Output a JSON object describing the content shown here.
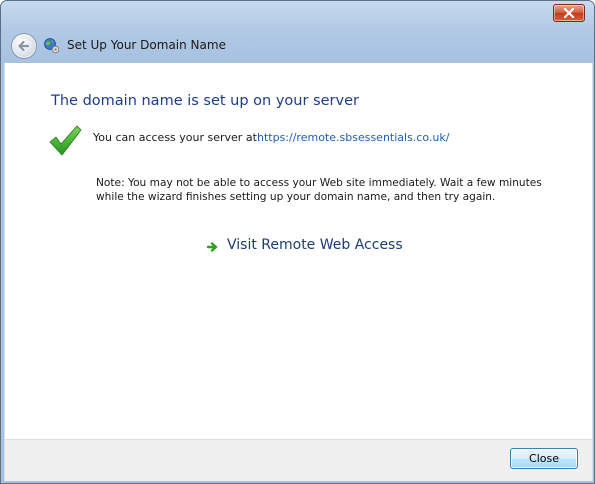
{
  "window": {
    "title": "Set Up Your Domain Name",
    "close_glyph": "×"
  },
  "icons": {
    "back": "back-arrow-icon",
    "wizard": "globe-network-icon",
    "success": "green-checkmark-icon",
    "link_arrow": "green-arrow-icon",
    "close": "close-icon"
  },
  "main": {
    "heading": "The domain name is set up on your server",
    "access_label": "You can access your server at:",
    "access_url": "https://remote.sbsessentials.co.uk/",
    "note": "Note: You may not be able to access your Web site immediately. Wait a few minutes while the wizard finishes setting up your domain name, and then try again.",
    "remote_link_label": "Visit Remote Web Access"
  },
  "footer": {
    "close_label": "Close"
  },
  "colors": {
    "heading": "#1e3c8a",
    "link": "#1f5fb4",
    "success_green": "#2fa11e",
    "titlebar": "#b2cae6"
  }
}
